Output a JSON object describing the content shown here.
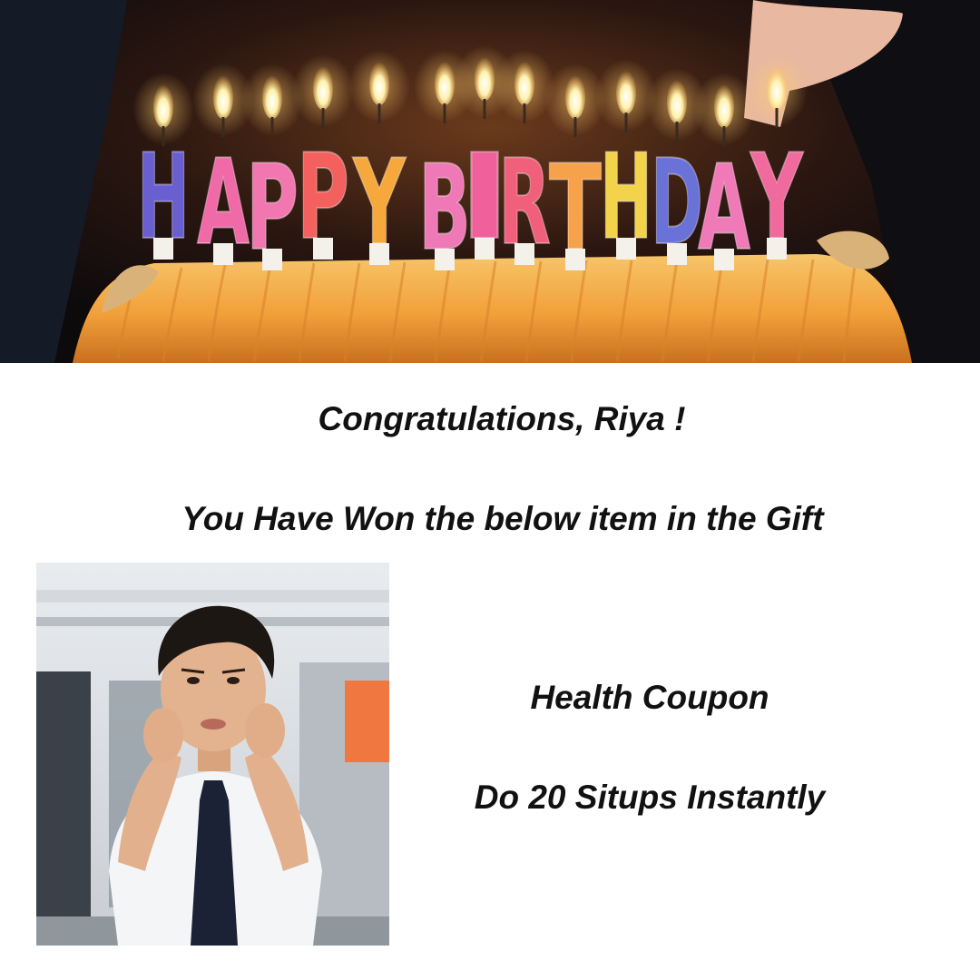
{
  "banner": {
    "candle_letters": [
      "H",
      "A",
      "P",
      "P",
      "Y",
      "B",
      "I",
      "R",
      "T",
      "H",
      "D",
      "A",
      "Y"
    ],
    "candle_colors": [
      "#6a5fd1",
      "#f06aa8",
      "#f277b0",
      "#f4605e",
      "#f6a83c",
      "#ef78b6",
      "#f0609a",
      "#f0607a",
      "#f6a24a",
      "#f2d34a",
      "#6a72d8",
      "#f07ab8",
      "#f06a9e"
    ]
  },
  "message": {
    "congratulations": "Congratulations, Riya !",
    "subtitle": "You Have Won the below item in the Gift"
  },
  "gift": {
    "title": "Health Coupon",
    "description": "Do 20 Situps Instantly"
  },
  "colors": {
    "text": "#111111",
    "cake": "#f2a03a",
    "background": "#ffffff"
  }
}
